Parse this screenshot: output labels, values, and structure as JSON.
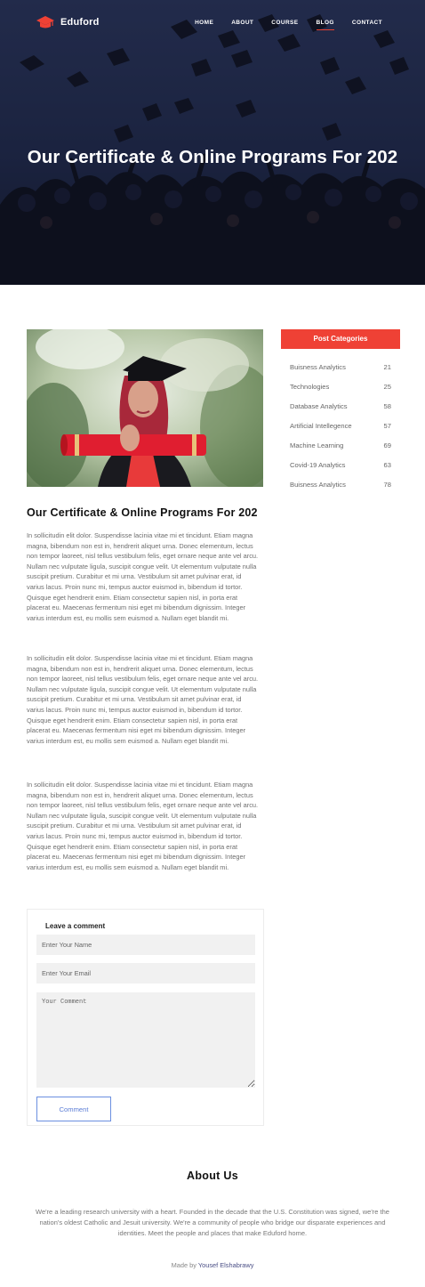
{
  "brand": {
    "name": "Eduford",
    "accent": "#ef4135"
  },
  "nav": {
    "items": [
      "HOME",
      "ABOUT",
      "COURSE",
      "BLOG",
      "CONTACT"
    ],
    "active": "BLOG"
  },
  "hero": {
    "title": "Our Certificate & Online Programs For 202"
  },
  "article": {
    "title": "Our Certificate & Online Programs For 202",
    "paragraphs": [
      "In sollicitudin elit dolor. Suspendisse lacinia vitae mi et tincidunt. Etiam magna magna, bibendum non est in, hendrerit aliquet urna. Donec elementum, lectus non tempor laoreet, nisl tellus vestibulum felis, eget ornare neque ante vel arcu. Nullam nec vulputate ligula, suscipit congue velit. Ut elementum vulputate nulla suscipit pretium. Curabitur et mi urna. Vestibulum sit amet pulvinar erat, id varius lacus. Proin nunc mi, tempus auctor euismod in, bibendum id tortor. Quisque eget hendrerit enim. Etiam consectetur sapien nisl, in porta erat placerat eu. Maecenas fermentum nisi eget mi bibendum dignissim. Integer varius interdum est, eu mollis sem euismod a. Nullam eget blandit mi.",
      "In sollicitudin elit dolor. Suspendisse lacinia vitae mi et tincidunt. Etiam magna magna, bibendum non est in, hendrerit aliquet urna. Donec elementum, lectus non tempor laoreet, nisl tellus vestibulum felis, eget ornare neque ante vel arcu. Nullam nec vulputate ligula, suscipit congue velit. Ut elementum vulputate nulla suscipit pretium. Curabitur et mi urna. Vestibulum sit amet pulvinar erat, id varius lacus. Proin nunc mi, tempus auctor euismod in, bibendum id tortor. Quisque eget hendrerit enim. Etiam consectetur sapien nisl, in porta erat placerat eu. Maecenas fermentum nisi eget mi bibendum dignissim. Integer varius interdum est, eu mollis sem euismod a. Nullam eget blandit mi.",
      "In sollicitudin elit dolor. Suspendisse lacinia vitae mi et tincidunt. Etiam magna magna, bibendum non est in, hendrerit aliquet urna. Donec elementum, lectus non tempor laoreet, nisl tellus vestibulum felis, eget ornare neque ante vel arcu. Nullam nec vulputate ligula, suscipit congue velit. Ut elementum vulputate nulla suscipit pretium. Curabitur et mi urna. Vestibulum sit amet pulvinar erat, id varius lacus. Proin nunc mi, tempus auctor euismod in, bibendum id tortor. Quisque eget hendrerit enim. Etiam consectetur sapien nisl, in porta erat placerat eu. Maecenas fermentum nisi eget mi bibendum dignissim. Integer varius interdum est, eu mollis sem euismod a. Nullam eget blandit mi."
    ]
  },
  "sidebar": {
    "header": "Post Categories",
    "categories": [
      {
        "name": "Buisness Analytics",
        "count": "21"
      },
      {
        "name": "Technologies",
        "count": "25"
      },
      {
        "name": "Database Analytics",
        "count": "58"
      },
      {
        "name": "Artificial Intellegence",
        "count": "57"
      },
      {
        "name": "Machine Learning",
        "count": "69"
      },
      {
        "name": "Covid-19 Analytics",
        "count": "63"
      },
      {
        "name": "Buisness Analytics",
        "count": "78"
      }
    ]
  },
  "comment_form": {
    "title": "Leave a comment",
    "name_placeholder": "Enter Your Name",
    "email_placeholder": "Enter Your Email",
    "comment_placeholder": "Your Comment",
    "button_label": "Comment"
  },
  "about": {
    "title": "About Us",
    "text": "We're a leading research university with a heart. Founded in the decade that the U.S. Constitution was signed, we're the nation's oldest Catholic and Jesuit university. We're a community of people who bridge our disparate experiences and identities. Meet the people and places that make Eduford home."
  },
  "footer": {
    "prefix": "Made by ",
    "author": "Yousef Elshabrawy"
  }
}
